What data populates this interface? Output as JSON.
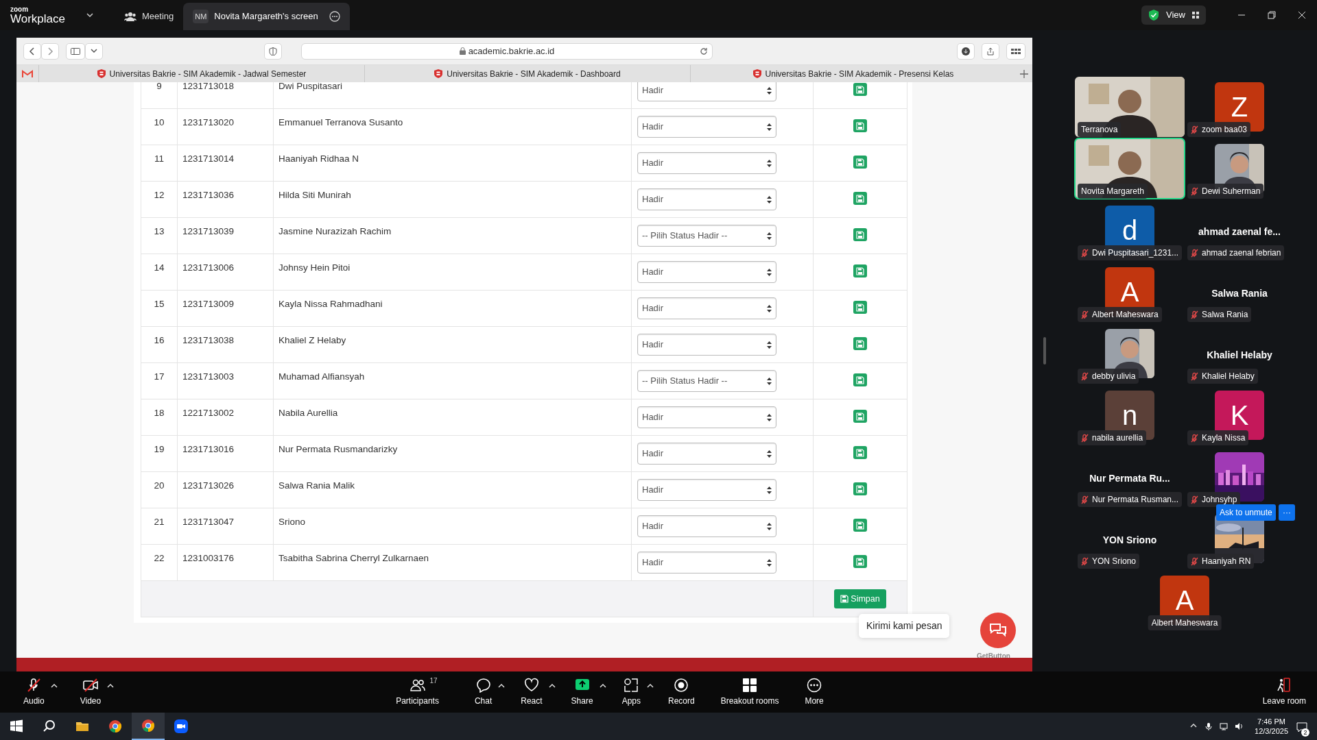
{
  "zoom_bar": {
    "logo_top": "zoom",
    "logo_bottom": "Workplace",
    "tabs": [
      {
        "label": "Meeting",
        "kind": "meeting",
        "selected": false
      },
      {
        "label": "Novita Margareth's screen",
        "initials": "NM",
        "kind": "share",
        "selected": true
      }
    ],
    "view_label": "View"
  },
  "browser": {
    "address": "academic.bakrie.ac.id",
    "tabs": [
      {
        "title": "Universitas Bakrie - SIM Akademik - Jadwal Semester"
      },
      {
        "title": "Universitas Bakrie - SIM Akademik - Dashboard"
      },
      {
        "title": "Universitas Bakrie - SIM Akademik - Presensi Kelas"
      }
    ]
  },
  "table": {
    "rows": [
      {
        "no": "9",
        "nim": "1231713018",
        "name": "Dwi Puspitasari",
        "status": "Hadir"
      },
      {
        "no": "10",
        "nim": "1231713020",
        "name": "Emmanuel Terranova Susanto",
        "status": "Hadir"
      },
      {
        "no": "11",
        "nim": "1231713014",
        "name": "Haaniyah Ridhaa N",
        "status": "Hadir"
      },
      {
        "no": "12",
        "nim": "1231713036",
        "name": "Hilda Siti Munirah",
        "status": "Hadir"
      },
      {
        "no": "13",
        "nim": "1231713039",
        "name": "Jasmine Nurazizah Rachim",
        "status": "-- Pilih Status Hadir --"
      },
      {
        "no": "14",
        "nim": "1231713006",
        "name": "Johnsy Hein Pitoi",
        "status": "Hadir"
      },
      {
        "no": "15",
        "nim": "1231713009",
        "name": "Kayla Nissa Rahmadhani",
        "status": "Hadir"
      },
      {
        "no": "16",
        "nim": "1231713038",
        "name": "Khaliel Z Helaby",
        "status": "Hadir"
      },
      {
        "no": "17",
        "nim": "1231713003",
        "name": "Muhamad Alfiansyah",
        "status": "-- Pilih Status Hadir --"
      },
      {
        "no": "18",
        "nim": "1221713002",
        "name": "Nabila Aurellia",
        "status": "Hadir"
      },
      {
        "no": "19",
        "nim": "1231713016",
        "name": "Nur Permata Rusmandarizky",
        "status": "Hadir"
      },
      {
        "no": "20",
        "nim": "1231713026",
        "name": "Salwa Rania Malik",
        "status": "Hadir"
      },
      {
        "no": "21",
        "nim": "1231713047",
        "name": "Sriono",
        "status": "Hadir"
      },
      {
        "no": "22",
        "nim": "1231003176",
        "name": "Tsabitha Sabrina Cherryl Zulkarnaen",
        "status": "Hadir"
      }
    ],
    "save_button": "Simpan"
  },
  "chat_widget": {
    "tooltip": "Kirimi kami pesan",
    "brand": "GetButton"
  },
  "participants": [
    {
      "label": "Terranova",
      "kind": "video",
      "muted": false,
      "speaking": false
    },
    {
      "label": "zoom baa03",
      "kind": "avatar",
      "display": "Z",
      "color": "#c1360f",
      "muted": true,
      "speaking": false
    },
    {
      "label": "Novita Margareth",
      "kind": "video",
      "muted": false,
      "speaking": true
    },
    {
      "label": "Dewi Suherman",
      "muted": true,
      "speaking": false
    },
    {
      "label": "Dwi Puspitasari_1231...",
      "kind": "avatar",
      "display": "d",
      "color": "#0e5ca8",
      "muted": true,
      "speaking": false
    },
    {
      "label": "ahmad zaenal febrian",
      "kind": "name",
      "display": "ahmad zaenal fe...",
      "muted": true,
      "speaking": false
    },
    {
      "label": "Albert Maheswara",
      "kind": "avatar",
      "display": "A",
      "color": "#c1360f",
      "muted": true,
      "speaking": false
    },
    {
      "label": "Salwa Rania",
      "kind": "name",
      "display": "Salwa Rania",
      "muted": true,
      "speaking": false
    },
    {
      "label": "debby ulivia",
      "muted": true,
      "speaking": false
    },
    {
      "label": "Khaliel Helaby",
      "kind": "name",
      "display": "Khaliel Helaby",
      "muted": true,
      "speaking": false
    },
    {
      "label": "nabila aurellia",
      "kind": "avatar",
      "display": "n",
      "color": "#5b4038",
      "muted": true,
      "speaking": false
    },
    {
      "label": "Kayla Nissa",
      "kind": "avatar",
      "display": "K",
      "color": "#c4185a",
      "muted": true,
      "speaking": false
    },
    {
      "label": "Nur Permata Rusman...",
      "kind": "name",
      "display": "Nur Permata Ru...",
      "muted": true,
      "speaking": false
    },
    {
      "label": "Johnsyhp",
      "kind": "city",
      "muted": true,
      "speaking": false
    },
    {
      "label": "YON Sriono",
      "kind": "name",
      "display": "YON Sriono",
      "muted": true,
      "speaking": false
    },
    {
      "label": "Haaniyah RN",
      "kind": "sunset",
      "muted": true,
      "speaking": false,
      "actions": [
        "Ask to unmute",
        "···"
      ]
    },
    {
      "label": "Albert Maheswara",
      "kind": "avatar",
      "display": "A",
      "color": "#c1360f",
      "muted": false,
      "speaking": false
    }
  ],
  "toolbar": [
    {
      "label": "Audio",
      "kind": "audio",
      "off": true,
      "caret": true
    },
    {
      "label": "Video",
      "kind": "video",
      "off": true,
      "caret": true
    },
    {
      "label": "Participants",
      "kind": "participants",
      "count": "17",
      "off": false,
      "caret": false
    },
    {
      "label": "Chat",
      "kind": "chat",
      "off": false,
      "caret": true
    },
    {
      "label": "React",
      "kind": "react",
      "off": false,
      "caret": true
    },
    {
      "label": "Share",
      "kind": "share",
      "off": false,
      "caret": true
    },
    {
      "label": "Apps",
      "kind": "apps",
      "off": false,
      "caret": true
    },
    {
      "label": "Record",
      "kind": "record",
      "off": false,
      "caret": false
    },
    {
      "label": "Breakout rooms",
      "kind": "breakout",
      "off": false,
      "caret": false
    },
    {
      "label": "More",
      "kind": "more",
      "off": false,
      "caret": false
    },
    {
      "label": "Leave room",
      "kind": "leave",
      "off": false,
      "caret": false
    }
  ],
  "taskbar": {
    "apps": [
      {
        "kind": "start",
        "active": false
      },
      {
        "kind": "search",
        "active": false
      },
      {
        "kind": "folder",
        "active": false
      },
      {
        "kind": "chrome",
        "active": false
      },
      {
        "kind": "chrome",
        "active": true
      },
      {
        "kind": "zoom",
        "active": false
      }
    ],
    "time": "7:46 PM",
    "date": "12/3/2025",
    "notifications": "2"
  }
}
